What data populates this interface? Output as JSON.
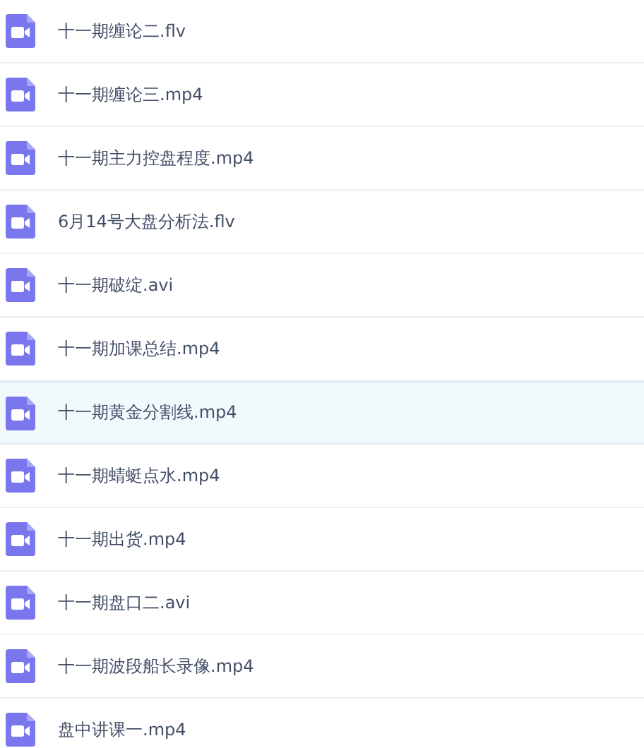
{
  "files": [
    {
      "name": "十一期缠论二.flv",
      "selected": false
    },
    {
      "name": "十一期缠论三.mp4",
      "selected": false
    },
    {
      "name": "十一期主力控盘程度.mp4",
      "selected": false
    },
    {
      "name": "6月14号大盘分析法.flv",
      "selected": false
    },
    {
      "name": "十一期破绽.avi",
      "selected": false
    },
    {
      "name": "十一期加课总结.mp4",
      "selected": false
    },
    {
      "name": "十一期黄金分割线.mp4",
      "selected": true
    },
    {
      "name": "十一期蜻蜓点水.mp4",
      "selected": false
    },
    {
      "name": "十一期出货.mp4",
      "selected": false
    },
    {
      "name": "十一期盘口二.avi",
      "selected": false
    },
    {
      "name": "十一期波段船长录像.mp4",
      "selected": false
    },
    {
      "name": "盘中讲课一.mp4",
      "selected": false
    }
  ]
}
